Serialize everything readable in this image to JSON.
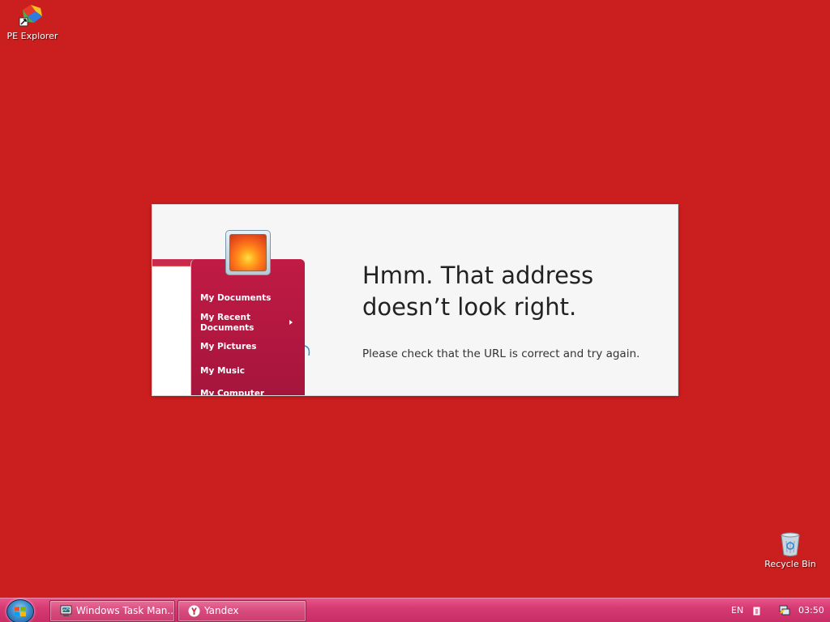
{
  "desktop": {
    "background_color": "#cb1e1e",
    "icons": [
      {
        "label": "PE Explorer",
        "icon": "pe-explorer-icon"
      },
      {
        "label": "Recycle Bin",
        "icon": "recycle-bin-icon"
      }
    ]
  },
  "error_page": {
    "title": "Hmm. That address doesn’t look right.",
    "message": "Please check that the URL is correct and try again.",
    "illustration_menu": {
      "items": [
        "My Documents",
        "My Recent Documents",
        "My Pictures",
        "My Music",
        "My Computer"
      ]
    }
  },
  "taskbar": {
    "start_icon": "windows-start-icon",
    "buttons": [
      {
        "label": "Windows Task Man...",
        "icon": "task-manager-icon"
      },
      {
        "label": "Yandex",
        "icon": "yandex-icon"
      }
    ],
    "tray": {
      "language": "EN",
      "clock": "03:50"
    }
  }
}
